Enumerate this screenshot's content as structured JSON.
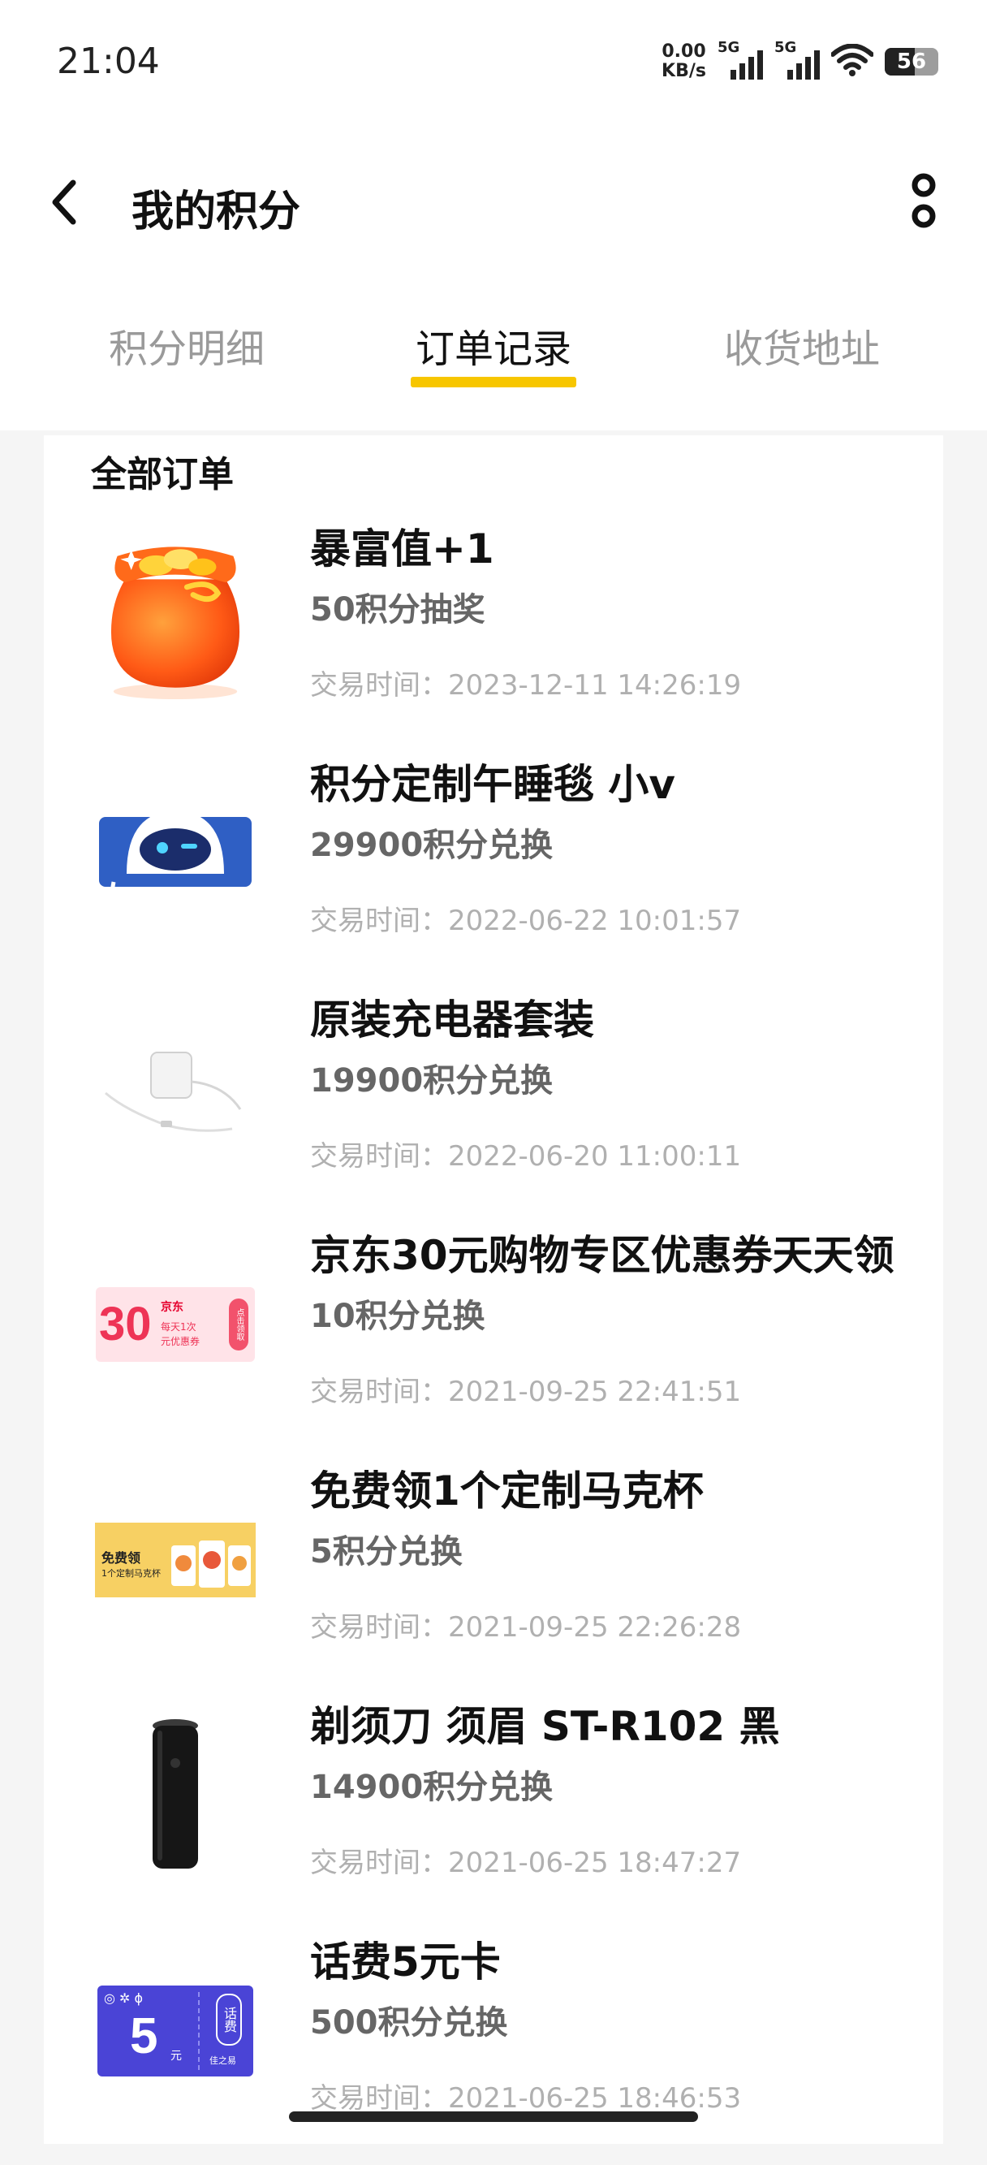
{
  "status_bar": {
    "time": "21:04",
    "net_speed_value": "0.00",
    "net_speed_unit": "KB/s",
    "signal1_label": "5G",
    "signal2_label": "5G",
    "battery_level": "56",
    "icons": [
      "signal-5g-icon",
      "signal-5g-icon",
      "wifi-icon",
      "battery-icon"
    ]
  },
  "header": {
    "title": "我的积分",
    "back_icon": "chevron-left-icon",
    "more_icon": "more-vertical-icon"
  },
  "tabs": [
    {
      "label": "积分明细",
      "active": false
    },
    {
      "label": "订单记录",
      "active": true
    },
    {
      "label": "收货地址",
      "active": false
    }
  ],
  "accent_color": "#f7c600",
  "orders_section": {
    "title": "全部订单",
    "items": [
      {
        "name": "暴富值+1",
        "price": "50积分抽奖",
        "time": "交易时间：2023-12-11 14:26:19",
        "image": "lucky-bag"
      },
      {
        "name": "积分定制午睡毯 小v",
        "price": "29900积分兑换",
        "time": "交易时间：2022-06-22 10:01:57",
        "image": "nap-blanket"
      },
      {
        "name": "原装充电器套装",
        "price": "19900积分兑换",
        "time": "交易时间：2022-06-20 11:00:11",
        "image": "charger"
      },
      {
        "name": "京东30元购物专区优惠券天天领",
        "price": "10积分兑换",
        "time": "交易时间：2021-09-25 22:41:51",
        "image": "jd-coupon",
        "thumb_big": "30",
        "thumb_brand": "京东",
        "thumb_line1": "每天1次",
        "thumb_line2": "元优惠券",
        "thumb_side": "点击领取"
      },
      {
        "name": "免费领1个定制马克杯",
        "price": "5积分兑换",
        "time": "交易时间：2021-09-25 22:26:28",
        "image": "mug-banner",
        "thumb_line1": "免费领",
        "thumb_line2": "1个定制马克杯"
      },
      {
        "name": "剃须刀 须眉 ST-R102 黑",
        "price": "14900积分兑换",
        "time": "交易时间：2021-06-25 18:47:27",
        "image": "shaver"
      },
      {
        "name": "话费5元卡",
        "price": "500积分兑换",
        "time": "交易时间：2021-06-25 18:46:53",
        "image": "phone-card",
        "thumb_big": "5",
        "thumb_unit": "元",
        "thumb_side": "话费",
        "thumb_brand": "佳之易"
      }
    ]
  }
}
